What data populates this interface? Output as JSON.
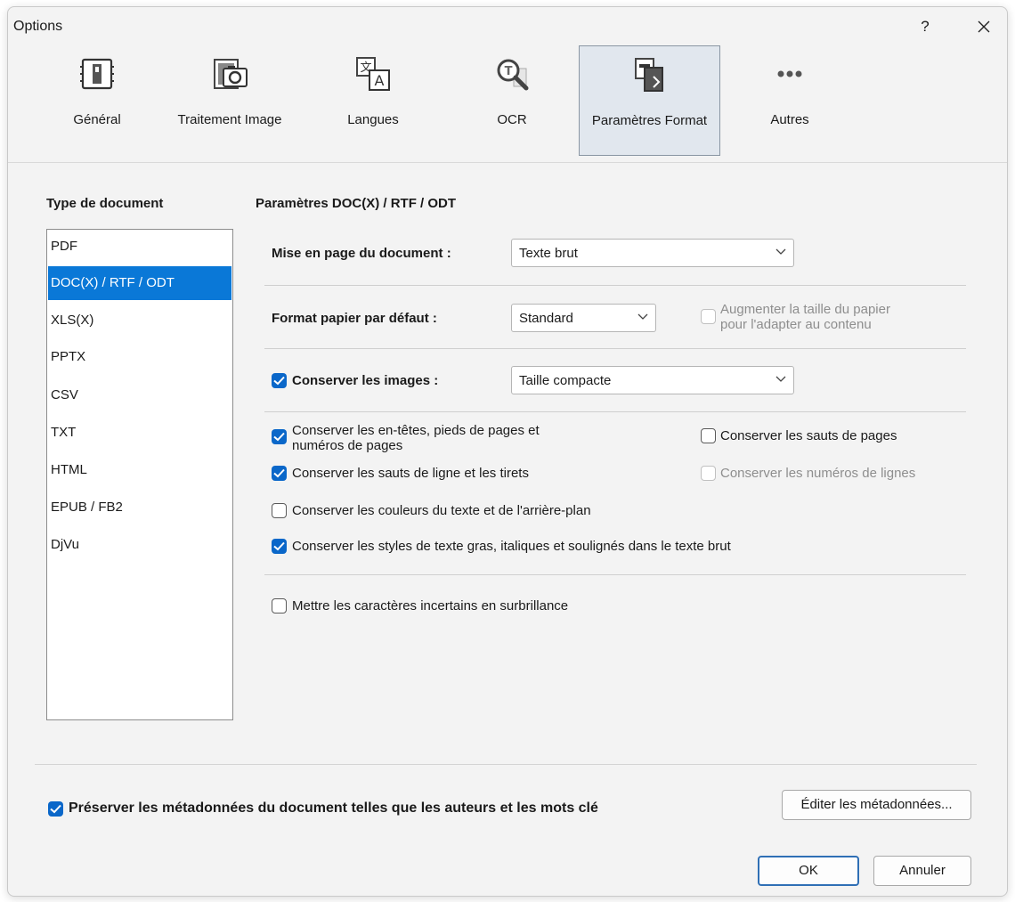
{
  "window": {
    "title": "Options",
    "help_label": "?"
  },
  "toolbar": [
    {
      "id": "general",
      "label": "Général",
      "icon": "general-settings-icon"
    },
    {
      "id": "image",
      "label": "Traitement Image",
      "icon": "image-processing-icon"
    },
    {
      "id": "languages",
      "label": "Langues",
      "icon": "languages-icon"
    },
    {
      "id": "ocr",
      "label": "OCR",
      "icon": "ocr-icon"
    },
    {
      "id": "format",
      "label": "Paramètres Format",
      "icon": "format-settings-icon",
      "active": true
    },
    {
      "id": "more",
      "label": "Autres",
      "icon": "more-dots-icon"
    }
  ],
  "left_header": "Type de document",
  "right_header": "Paramètres DOC(X) / RTF / ODT",
  "document_types": [
    "PDF",
    "DOC(X) / RTF / ODT",
    "XLS(X)",
    "PPTX",
    "CSV",
    "TXT",
    "HTML",
    "EPUB / FB2",
    "DjVu"
  ],
  "selected_document_type": "DOC(X) / RTF / ODT",
  "layout": {
    "label": "Mise en page du document :",
    "value": "Texte brut"
  },
  "paper": {
    "label": "Format papier par défaut :",
    "value": "Standard",
    "increase_label_1": "Augmenter la taille du papier",
    "increase_label_2": "pour l'adapter au contenu",
    "increase_checked": false
  },
  "images": {
    "label": "Conserver les images :",
    "checked": true,
    "value": "Taille compacte"
  },
  "options": {
    "headers_1": "Conserver les en-têtes, pieds de pages et",
    "headers_2": "numéros de pages",
    "headers_checked": true,
    "page_breaks": "Conserver les sauts de pages",
    "page_breaks_checked": false,
    "line_breaks": "Conserver les sauts de ligne et les tirets",
    "line_breaks_checked": true,
    "line_numbers": "Conserver les numéros de lignes",
    "line_numbers_checked": false,
    "colors": "Conserver les couleurs du texte et de l'arrière-plan",
    "colors_checked": false,
    "styles": "Conserver les styles de texte gras, italiques et soulignés dans le texte brut",
    "styles_checked": true
  },
  "highlight": {
    "label": "Mettre les caractères incertains en surbrillance",
    "checked": false
  },
  "metadata": {
    "label": "Préserver les métadonnées du document telles que les auteurs et les mots clé",
    "checked": true
  },
  "buttons": {
    "edit_metadata": "Éditer les métadonnées...",
    "ok": "OK",
    "cancel": "Annuler"
  },
  "colors": {
    "accent": "#0a67c9",
    "selection": "#0a78d7"
  }
}
